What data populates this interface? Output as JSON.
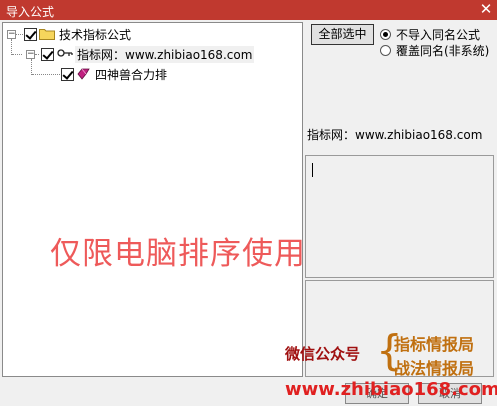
{
  "window": {
    "title": "导入公式",
    "close_symbol": "✕"
  },
  "tree": {
    "root": {
      "label": "技术指标公式",
      "expander": "−",
      "checked": true,
      "icon": "folder-icon"
    },
    "child": {
      "label": "指标网：www.zhibiao168.com",
      "expander": "−",
      "checked": true,
      "icon": "key-icon"
    },
    "leaf": {
      "label": "四神兽合力排",
      "checked": true,
      "icon": "gem-icon"
    }
  },
  "buttons": {
    "select_all": "全部选中",
    "ok": "确定",
    "cancel": "取消"
  },
  "options": [
    {
      "label": "不导入同名公式",
      "selected": true
    },
    {
      "label": "覆盖同名(非系统)",
      "selected": false
    }
  ],
  "info": {
    "source": "指标网：www.zhibiao168.com"
  },
  "watermark": {
    "center": "仅限电脑排序使用",
    "wechat": "微信公众号",
    "line1": "指标情报局",
    "line2": "战法情报局",
    "url": "www.zhibiao168.com"
  },
  "colors": {
    "titlebar": "#c0392f",
    "watermark_red": "#ee5a5a",
    "watermark_orange": "#c07010"
  }
}
